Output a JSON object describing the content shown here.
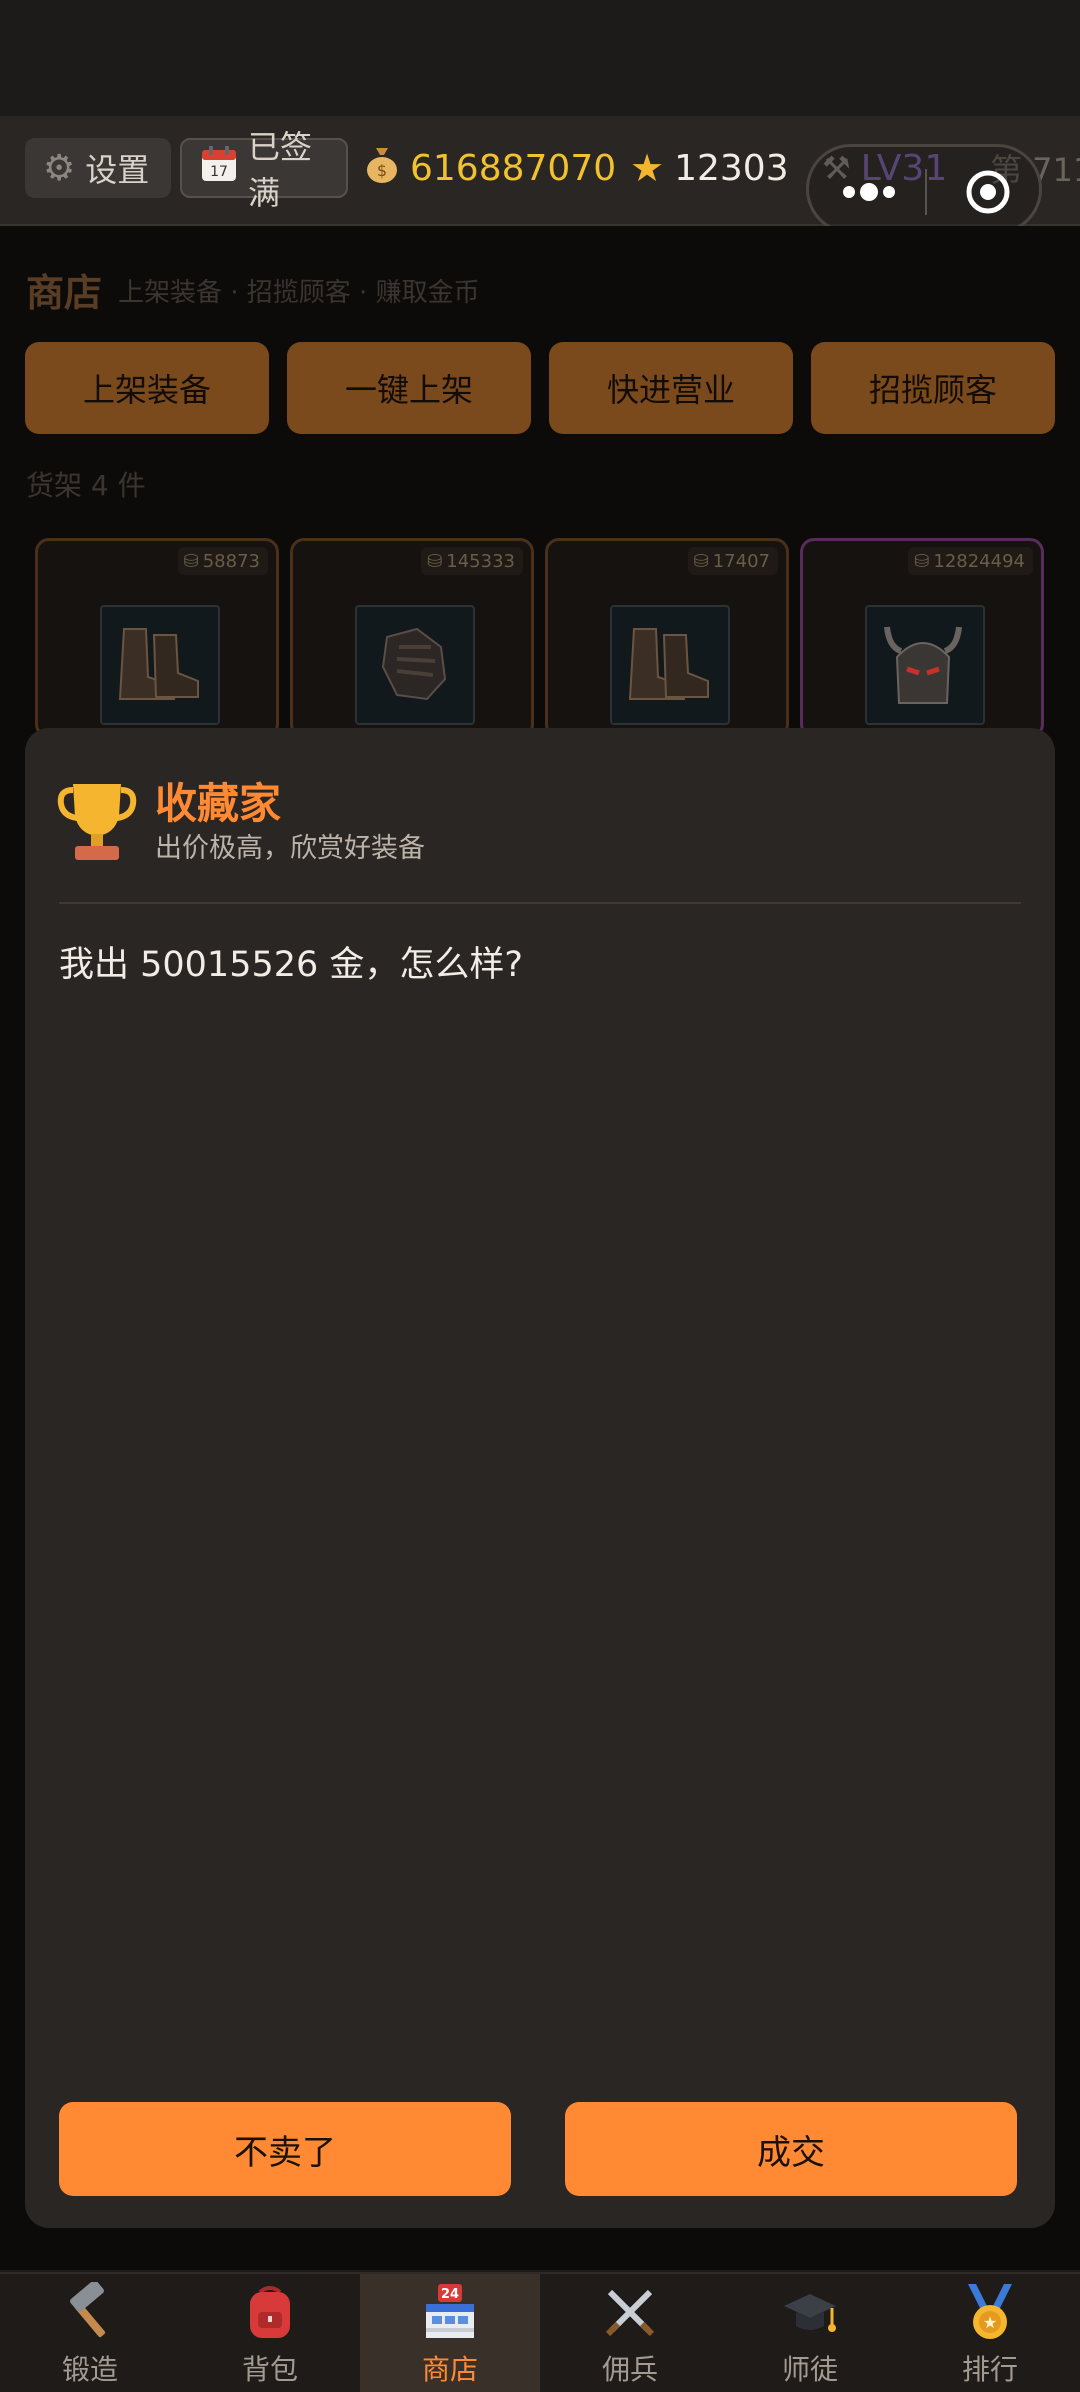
{
  "topbar": {
    "settings_label": "设置",
    "signin_label": "已签满",
    "gold": "616887070",
    "stars": "12303",
    "level": "LV31",
    "rank_text": "第 711"
  },
  "shop": {
    "title": "商店",
    "subtitle": "上架装备 · 招揽顾客 · 赚取金币",
    "actions": [
      "上架装备",
      "一键上架",
      "快进营业",
      "招揽顾客"
    ],
    "shelf_count": "货架 4 件",
    "items": [
      {
        "price": "58873",
        "icon": "boots-icon"
      },
      {
        "price": "145333",
        "icon": "gauntlet-icon"
      },
      {
        "price": "17407",
        "icon": "boots-icon"
      },
      {
        "price": "12824494",
        "icon": "helmet-icon"
      }
    ]
  },
  "modal": {
    "title": "收藏家",
    "subtitle": "出价极高，欣赏好装备",
    "message": "我出 50015526 金，怎么样?",
    "decline_label": "不卖了",
    "accept_label": "成交"
  },
  "nav": {
    "items": [
      {
        "label": "锻造",
        "icon": "hammer-icon"
      },
      {
        "label": "背包",
        "icon": "backpack-icon"
      },
      {
        "label": "商店",
        "icon": "shop-icon"
      },
      {
        "label": "佣兵",
        "icon": "crossed-swords-icon"
      },
      {
        "label": "师徒",
        "icon": "graduation-cap-icon"
      },
      {
        "label": "排行",
        "icon": "medal-icon"
      }
    ],
    "active": "商店"
  },
  "colors": {
    "accent": "#ff8a33",
    "gold": "#f2c12e",
    "modal_bg": "#2a2623"
  }
}
